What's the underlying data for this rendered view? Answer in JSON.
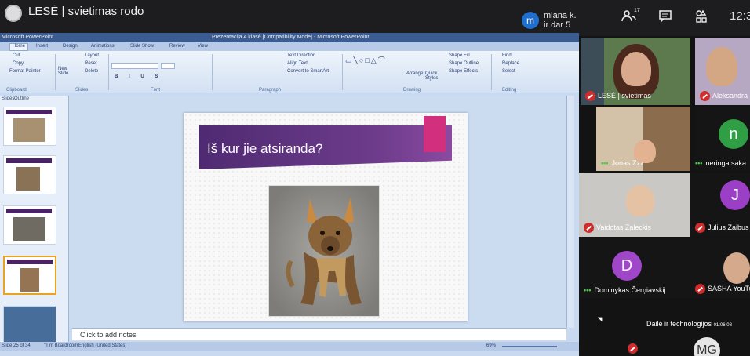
{
  "meeting": {
    "title": "LESĖ | svietimas rodo",
    "notification": {
      "avatar_letter": "m",
      "line1": "mlana k.",
      "line2": "ir dar 5"
    },
    "participants_count": "17",
    "time": "12:3"
  },
  "ppt": {
    "app_title": "Microsoft PowerPoint",
    "window_title": "Prezentacija 4 klasė [Compatibility Mode] - Microsoft PowerPoint",
    "tabs": [
      "Home",
      "Insert",
      "Design",
      "Animations",
      "Slide Show",
      "Review",
      "View"
    ],
    "ribbon": {
      "clipboard": {
        "label": "Clipboard",
        "cut": "Cut",
        "copy": "Copy",
        "format_painter": "Format Painter"
      },
      "slides": {
        "label": "Slides",
        "new_slide": "New Slide",
        "layout": "Layout",
        "reset": "Reset",
        "delete": "Delete"
      },
      "font": {
        "label": "Font"
      },
      "paragraph": {
        "label": "Paragraph",
        "text_direction": "Text Direction",
        "align_text": "Align Text",
        "convert": "Convert to SmartArt"
      },
      "drawing": {
        "label": "Drawing",
        "arrange": "Arrange",
        "quick_styles": "Quick Styles",
        "shape_fill": "Shape Fill",
        "shape_outline": "Shape Outline",
        "shape_effects": "Shape Effects"
      },
      "editing": {
        "label": "Editing",
        "find": "Find",
        "replace": "Replace",
        "select": "Select"
      }
    },
    "panel_tabs": [
      "Slides",
      "Outline"
    ],
    "slide_title": "Iš kur jie atsiranda?",
    "notes_placeholder": "Click to add notes",
    "status": {
      "slide": "Slide 25 of 34",
      "theme": "\"Tim Boardroom\"",
      "language": "English (United States)",
      "zoom": "69%"
    }
  },
  "participants": [
    {
      "name": "LESĖ | svietimas",
      "muted": true
    },
    {
      "name": "Aleksandra",
      "muted": true
    },
    {
      "name": "Jonas Zzz",
      "muted": false
    },
    {
      "name": "neringa saka",
      "muted": false,
      "letter": "n",
      "color": "#2f9e44"
    },
    {
      "name": "Vaidotas Zaleckis",
      "muted": true
    },
    {
      "name": "Julius Zaibus",
      "muted": true,
      "letter": "J",
      "color": "#9b3fc6"
    },
    {
      "name": "Dominykas Čerņiavskij",
      "muted": false,
      "letter": "D",
      "color": "#a046c8"
    },
    {
      "name": "SASHA YouTub",
      "muted": true
    },
    {
      "name": "Dailė ir technologijos",
      "time": "01:06:08"
    },
    {
      "name": "MG",
      "muted": true
    }
  ]
}
